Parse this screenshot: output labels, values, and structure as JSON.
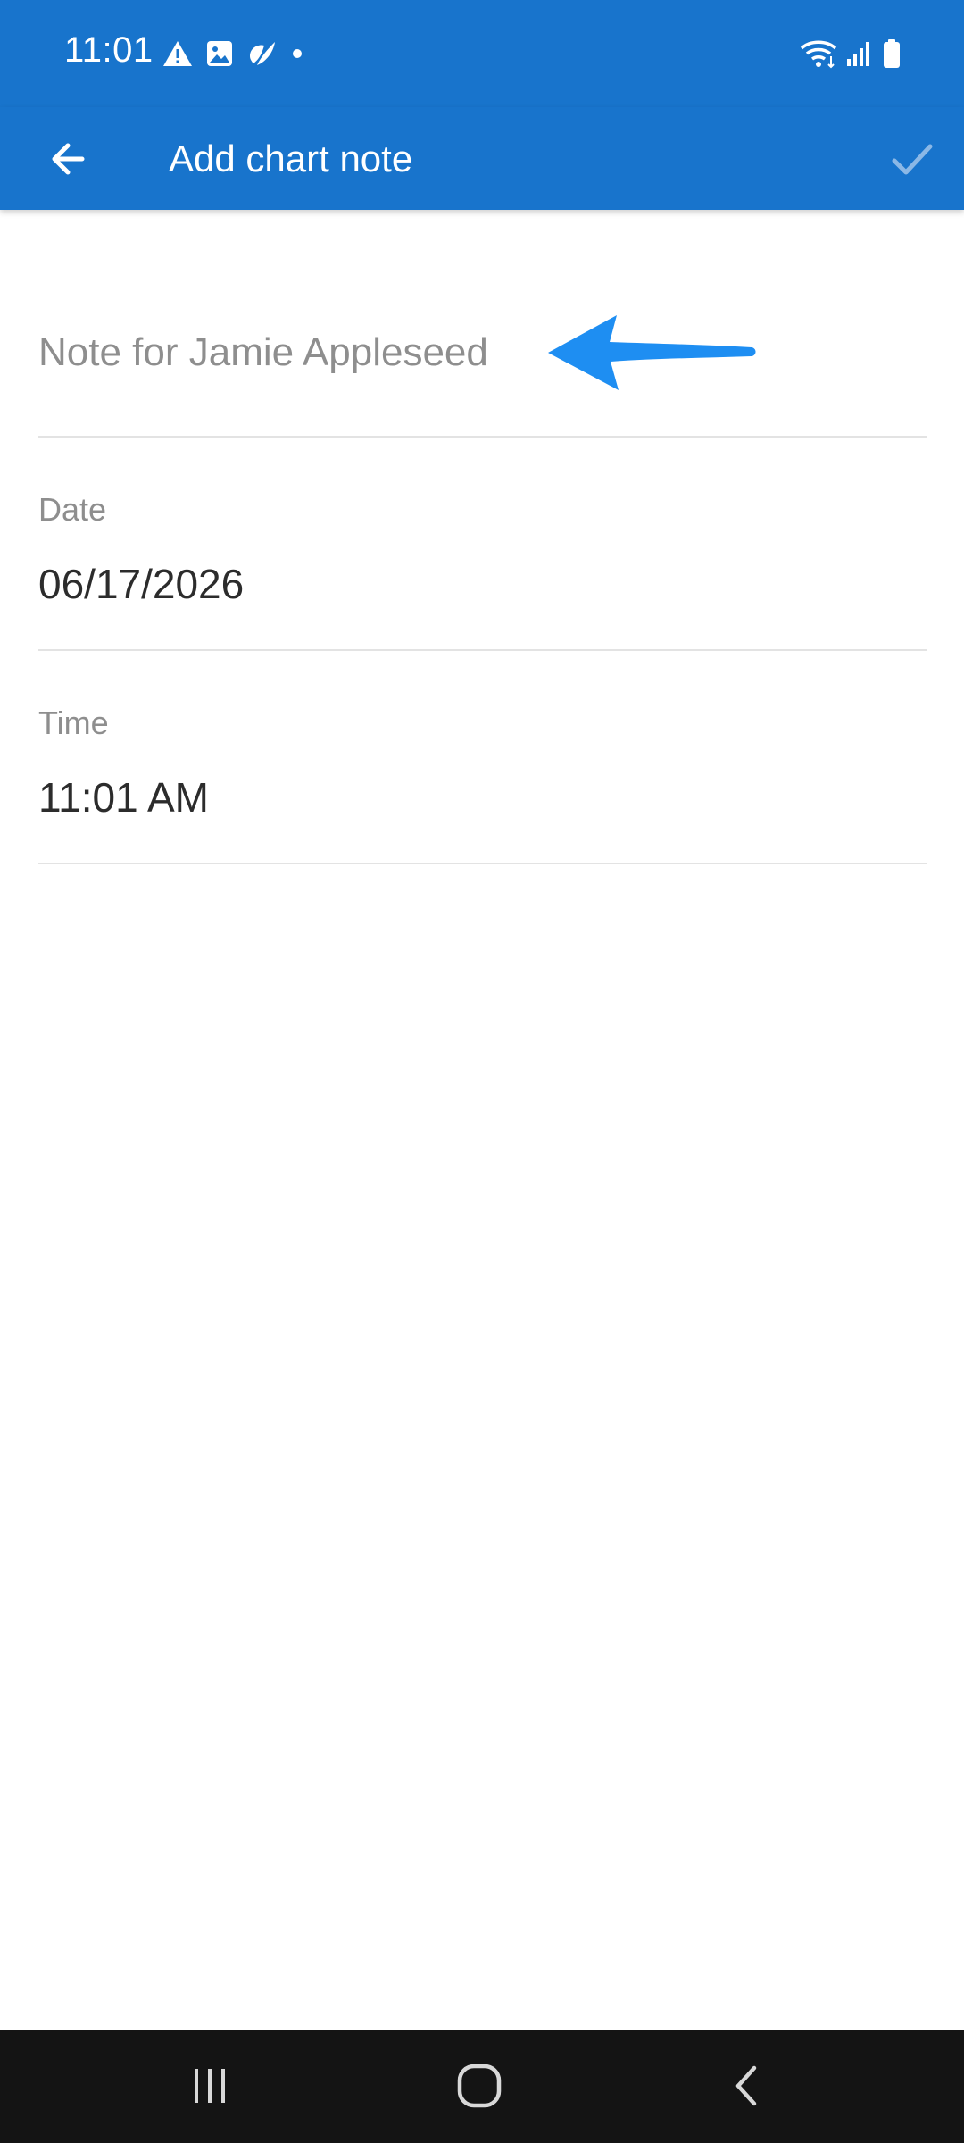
{
  "status_bar": {
    "time": "11:01",
    "left_icons": [
      "warning-icon",
      "image-icon",
      "leaf-icon",
      "dot-icon"
    ],
    "right_icons": [
      "wifi-icon",
      "signal-icon",
      "battery-icon"
    ]
  },
  "app_bar": {
    "title": "Add chart note",
    "back_icon": "arrow-left-icon",
    "confirm_icon": "check-icon"
  },
  "note": {
    "placeholder": "Note for Jamie Appleseed",
    "value": ""
  },
  "date_field": {
    "label": "Date",
    "value": "06/17/2026"
  },
  "time_field": {
    "label": "Time",
    "value": "11:01 AM"
  },
  "colors": {
    "primary": "#1874cc",
    "annotation_arrow": "#1e8ef2",
    "nav_bar": "#141414"
  },
  "nav_bar": {
    "icons": [
      "recent-apps-icon",
      "home-icon",
      "back-icon"
    ]
  }
}
